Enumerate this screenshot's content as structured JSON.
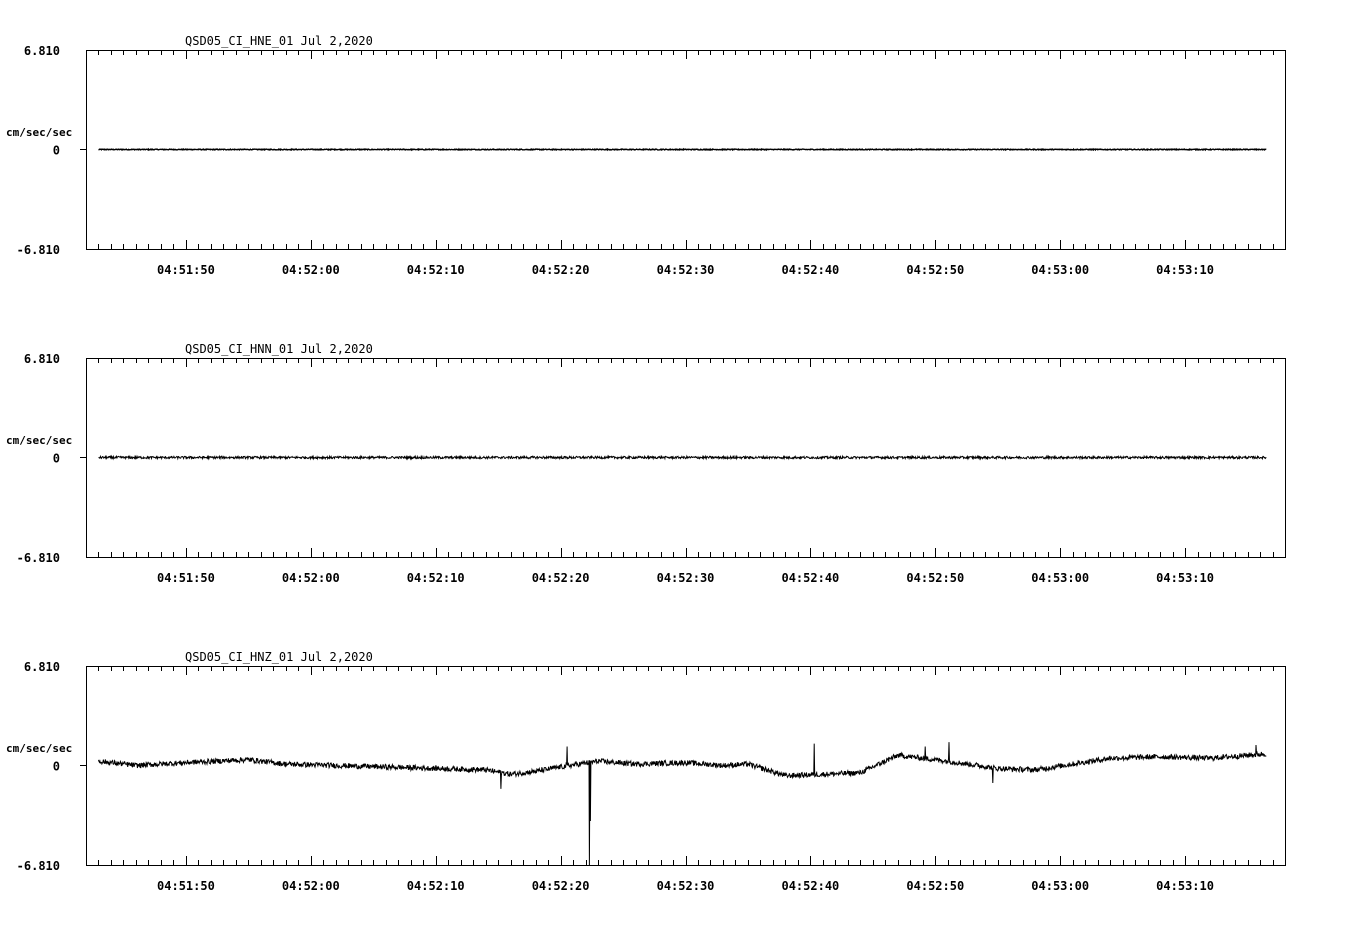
{
  "colors": {
    "background": "#ffffff",
    "ink": "#000000"
  },
  "chart_data": [
    {
      "type": "line",
      "title": "QSD05_CI_HNE_01  Jul 2,2020",
      "ylabel": "cm/sec/sec",
      "ylim": [
        -6.81,
        6.81
      ],
      "y_tick_labels": [
        "6.810",
        "0",
        "-6.810"
      ],
      "x_tick_labels": [
        "04:51:50",
        "04:52:00",
        "04:52:10",
        "04:52:20",
        "04:52:30",
        "04:52:40",
        "04:52:50",
        "04:53:00",
        "04:53:10"
      ],
      "x_range_seconds": [
        42,
        138
      ],
      "trace": {
        "start_seconds": 43,
        "end_seconds": 136.5,
        "baseline": 0,
        "noise_amplitude": 0.03
      },
      "grid": false
    },
    {
      "type": "line",
      "title": "QSD05_CI_HNN_01  Jul 2,2020",
      "ylabel": "cm/sec/sec",
      "ylim": [
        -6.81,
        6.81
      ],
      "y_tick_labels": [
        "6.810",
        "0",
        "-6.810"
      ],
      "x_tick_labels": [
        "04:51:50",
        "04:52:00",
        "04:52:10",
        "04:52:20",
        "04:52:30",
        "04:52:40",
        "04:52:50",
        "04:53:00",
        "04:53:10"
      ],
      "x_range_seconds": [
        42,
        138
      ],
      "trace": {
        "start_seconds": 43,
        "end_seconds": 136.5,
        "baseline": 0,
        "noise_amplitude": 0.08
      },
      "grid": false
    },
    {
      "type": "line",
      "title": "QSD05_CI_HNZ_01  Jul 2,2020",
      "ylabel": "cm/sec/sec",
      "ylim": [
        -6.81,
        6.81
      ],
      "y_tick_labels": [
        "6.810",
        "0",
        "-6.810"
      ],
      "x_tick_labels": [
        "04:51:50",
        "04:52:00",
        "04:52:10",
        "04:52:20",
        "04:52:30",
        "04:52:40",
        "04:52:50",
        "04:53:00",
        "04:53:10"
      ],
      "x_range_seconds": [
        42,
        138
      ],
      "trace": {
        "start_seconds": 43,
        "end_seconds": 136.5,
        "noise_amplitude": 0.18,
        "baseline_points": [
          [
            43,
            0.3
          ],
          [
            46,
            0.0
          ],
          [
            50,
            0.2
          ],
          [
            55,
            0.4
          ],
          [
            58,
            0.1
          ],
          [
            62,
            0.0
          ],
          [
            66,
            -0.1
          ],
          [
            70,
            -0.2
          ],
          [
            74,
            -0.3
          ],
          [
            76,
            -0.6
          ],
          [
            78,
            -0.4
          ],
          [
            80,
            -0.1
          ],
          [
            83,
            0.3
          ],
          [
            86,
            0.1
          ],
          [
            90,
            0.2
          ],
          [
            93,
            0.0
          ],
          [
            95,
            0.1
          ],
          [
            98,
            -0.7
          ],
          [
            101,
            -0.6
          ],
          [
            104,
            -0.5
          ],
          [
            107,
            0.7
          ],
          [
            111,
            0.3
          ],
          [
            115,
            -0.2
          ],
          [
            118,
            -0.3
          ],
          [
            121,
            0.1
          ],
          [
            124,
            0.5
          ],
          [
            128,
            0.6
          ],
          [
            132,
            0.5
          ],
          [
            136.5,
            0.8
          ]
        ],
        "spikes": [
          {
            "t": 75.2,
            "value": -1.6
          },
          {
            "t": 80.5,
            "value": 1.3
          },
          {
            "t": 82.3,
            "value": -6.81
          },
          {
            "t": 82.4,
            "value": -3.8
          },
          {
            "t": 100.3,
            "value": 1.5
          },
          {
            "t": 109.2,
            "value": 1.3
          },
          {
            "t": 111.1,
            "value": 1.6
          },
          {
            "t": 114.6,
            "value": -1.2
          },
          {
            "t": 135.7,
            "value": 1.4
          }
        ]
      },
      "grid": false
    }
  ]
}
